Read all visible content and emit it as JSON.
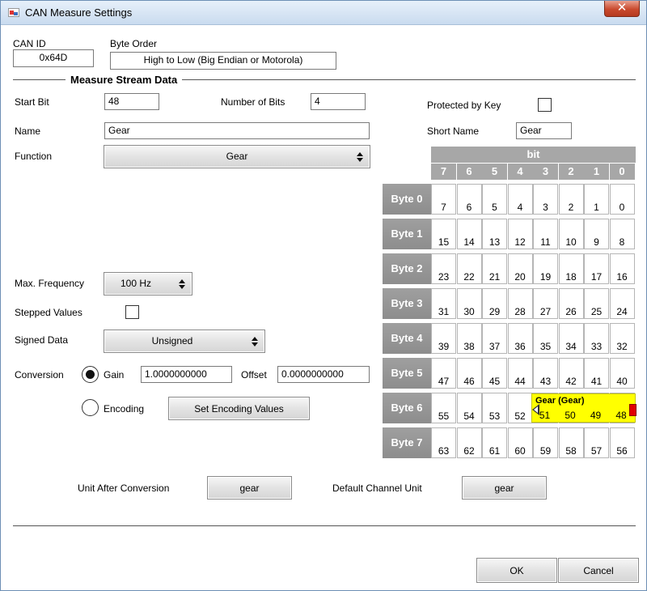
{
  "window": {
    "title": "CAN Measure Settings",
    "close_glyph": "✕"
  },
  "can_id": {
    "label": "CAN ID",
    "value": "0x64D"
  },
  "byte_order": {
    "label": "Byte Order",
    "value": "High to Low (Big Endian or Motorola)"
  },
  "section": {
    "title": "Measure Stream Data"
  },
  "start_bit": {
    "label": "Start Bit",
    "value": "48"
  },
  "num_bits": {
    "label": "Number of Bits",
    "value": "4"
  },
  "protected": {
    "label": "Protected by Key",
    "checked": false
  },
  "name": {
    "label": "Name",
    "value": "Gear"
  },
  "short_name": {
    "label": "Short Name",
    "value": "Gear"
  },
  "function": {
    "label": "Function",
    "value": "Gear"
  },
  "max_frequency": {
    "label": "Max. Frequency",
    "value": "100 Hz"
  },
  "stepped": {
    "label": "Stepped Values",
    "checked": false
  },
  "signed": {
    "label": "Signed Data",
    "value": "Unsigned"
  },
  "conversion": {
    "label": "Conversion",
    "gain_label": "Gain",
    "gain_value": "1.0000000000",
    "offset_label": "Offset",
    "offset_value": "0.0000000000",
    "encoding_label": "Encoding",
    "encoding_button": "Set Encoding Values",
    "selected": "gain"
  },
  "unit_after": {
    "label": "Unit After Conversion",
    "value": "gear"
  },
  "default_unit": {
    "label": "Default Channel Unit",
    "value": "gear"
  },
  "buttons": {
    "ok": "OK",
    "cancel": "Cancel"
  },
  "bit_grid": {
    "header": "bit",
    "columns": [
      "7",
      "6",
      "5",
      "4",
      "3",
      "2",
      "1",
      "0"
    ],
    "bytes": [
      {
        "label": "Byte 0",
        "bits": [
          "7",
          "6",
          "5",
          "4",
          "3",
          "2",
          "1",
          "0"
        ]
      },
      {
        "label": "Byte 1",
        "bits": [
          "15",
          "14",
          "13",
          "12",
          "11",
          "10",
          "9",
          "8"
        ]
      },
      {
        "label": "Byte 2",
        "bits": [
          "23",
          "22",
          "21",
          "20",
          "19",
          "18",
          "17",
          "16"
        ]
      },
      {
        "label": "Byte 3",
        "bits": [
          "31",
          "30",
          "29",
          "28",
          "27",
          "26",
          "25",
          "24"
        ]
      },
      {
        "label": "Byte 4",
        "bits": [
          "39",
          "38",
          "37",
          "36",
          "35",
          "34",
          "33",
          "32"
        ]
      },
      {
        "label": "Byte 5",
        "bits": [
          "47",
          "46",
          "45",
          "44",
          "43",
          "42",
          "41",
          "40"
        ]
      },
      {
        "label": "Byte 6",
        "bits": [
          "55",
          "54",
          "53",
          "52",
          "51",
          "50",
          "49",
          "48"
        ]
      },
      {
        "label": "Byte 7",
        "bits": [
          "63",
          "62",
          "61",
          "60",
          "59",
          "58",
          "57",
          "56"
        ]
      }
    ],
    "signal": {
      "label": "Gear (Gear)",
      "color": "#ffff00",
      "handle_color": "#e00000"
    }
  }
}
